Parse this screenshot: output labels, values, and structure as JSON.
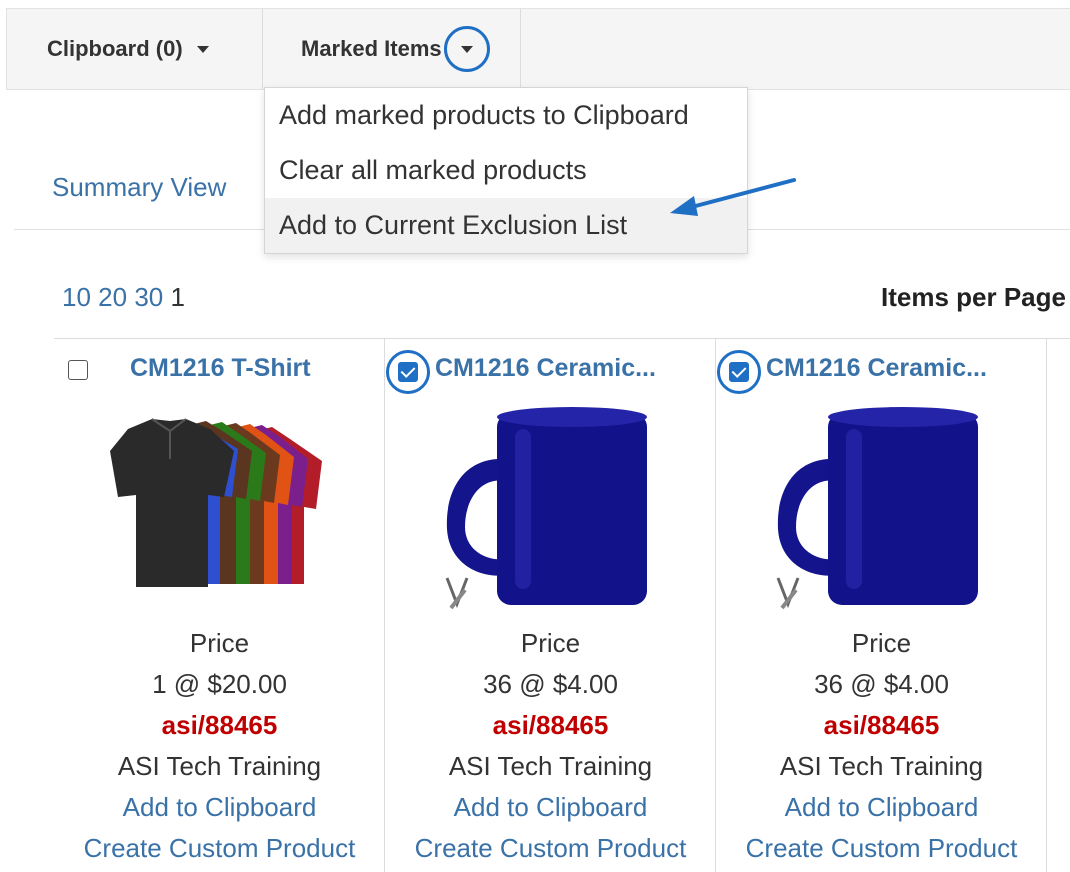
{
  "toolbar": {
    "clipboard_label": "Clipboard (0)",
    "marked_items_label": "Marked Items"
  },
  "dropdown": {
    "items": [
      {
        "label": "Add marked products to Clipboard"
      },
      {
        "label": "Clear all marked products"
      },
      {
        "label": "Add to Current Exclusion List"
      }
    ]
  },
  "view": {
    "summary_link": "Summary View"
  },
  "pager": {
    "sizes": [
      "10",
      "20",
      "30"
    ],
    "current_page": "1",
    "items_per_page_label": "Items per Page"
  },
  "products": [
    {
      "checked": false,
      "title": "CM1216  T-Shirt",
      "price_label": "Price",
      "price": "1 @ $20.00",
      "asi": "asi/88465",
      "supplier": "ASI Tech Training",
      "add_clipboard": "Add to Clipboard",
      "create_custom": "Create Custom Product"
    },
    {
      "checked": true,
      "title": "CM1216  Ceramic...",
      "price_label": "Price",
      "price": "36 @ $4.00",
      "asi": "asi/88465",
      "supplier": "ASI Tech Training",
      "add_clipboard": "Add to Clipboard",
      "create_custom": "Create Custom Product"
    },
    {
      "checked": true,
      "title": "CM1216  Ceramic...",
      "price_label": "Price",
      "price": "36 @ $4.00",
      "asi": "asi/88465",
      "supplier": "ASI Tech Training",
      "add_clipboard": "Add to Clipboard",
      "create_custom": "Create Custom Product"
    }
  ],
  "colors": {
    "link": "#3a72a8",
    "asi": "#c00000",
    "highlight_ring": "#1f6fc5",
    "mug": "#12128a"
  },
  "icons": [
    "caret-down-icon",
    "checkbox-icon",
    "decorating-tool-icon",
    "annotation-arrow-icon"
  ]
}
